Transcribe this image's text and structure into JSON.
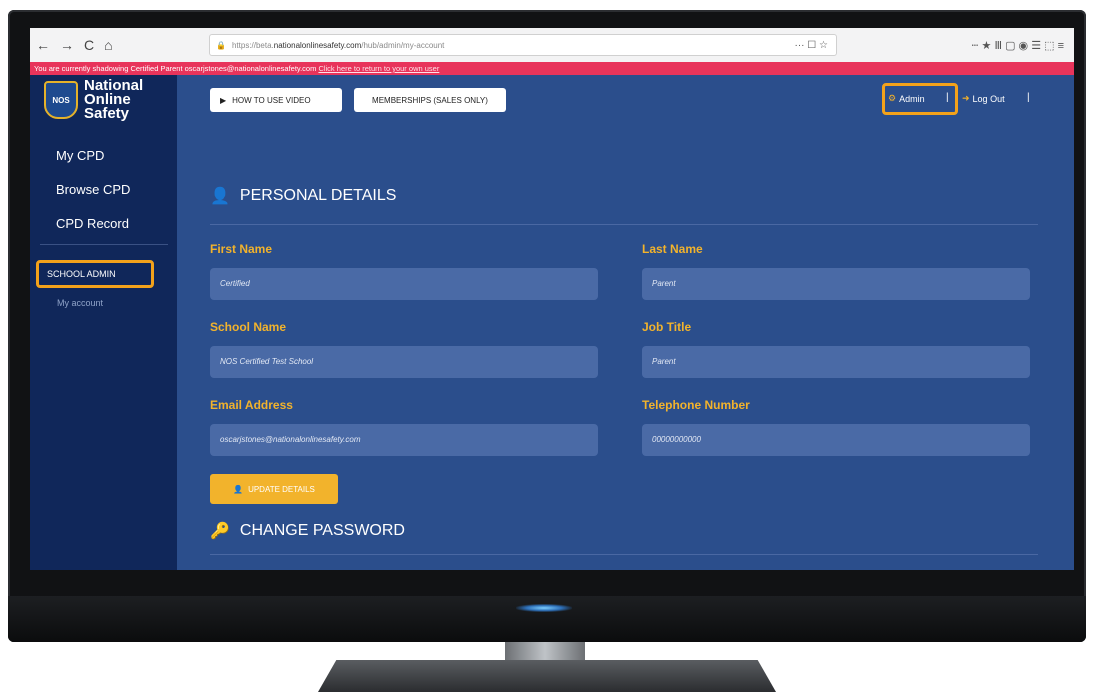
{
  "browser": {
    "nav": [
      "←",
      "→",
      "C",
      "⌂"
    ],
    "url_prefix": "https://beta.",
    "url_domain": "nationalonlinesafety.com",
    "url_path": "/hub/admin/my-account",
    "right_icons": "··· ☐ ☆",
    "extras": "ⵈ ★ Ⅲ ▢ ◉ ☰ ⬚ ≡"
  },
  "banner": {
    "text": "You are currently shadowing Certified Parent oscarjstones@nationalonlinesafety.com ",
    "link": "Click here to return to your own user"
  },
  "logo": {
    "badge": "NOS",
    "line1": "National",
    "line2": "Online",
    "line3": "Safety"
  },
  "sidebar": {
    "items": [
      "My CPD",
      "Browse CPD",
      "CPD Record"
    ],
    "school_admin": "SCHOOL ADMIN",
    "my_account": "My account"
  },
  "topbar": {
    "how_to_label": "HOW TO USE VIDEO",
    "memberships_label": "MEMBERSHIPS (SALES ONLY)",
    "admin_label": "Admin",
    "logout_label": "Log Out",
    "sep": "|"
  },
  "personal": {
    "title": "PERSONAL DETAILS",
    "first_name_label": "First Name",
    "first_name_value": "Certified",
    "last_name_label": "Last Name",
    "last_name_value": "Parent",
    "school_label": "School Name",
    "school_value": "NOS Certified Test School",
    "job_label": "Job Title",
    "job_value": "Parent",
    "email_label": "Email Address",
    "email_value": "oscarjstones@nationalonlinesafety.com",
    "phone_label": "Telephone Number",
    "phone_value": "00000000000",
    "update_label": "UPDATE DETAILS"
  },
  "password": {
    "title": "CHANGE PASSWORD"
  },
  "colors": {
    "accent": "#f2b32c",
    "highlight": "#f3a21b",
    "banner": "#e8345b",
    "panel": "#2b4e8c",
    "sidebar": "#10275a"
  }
}
